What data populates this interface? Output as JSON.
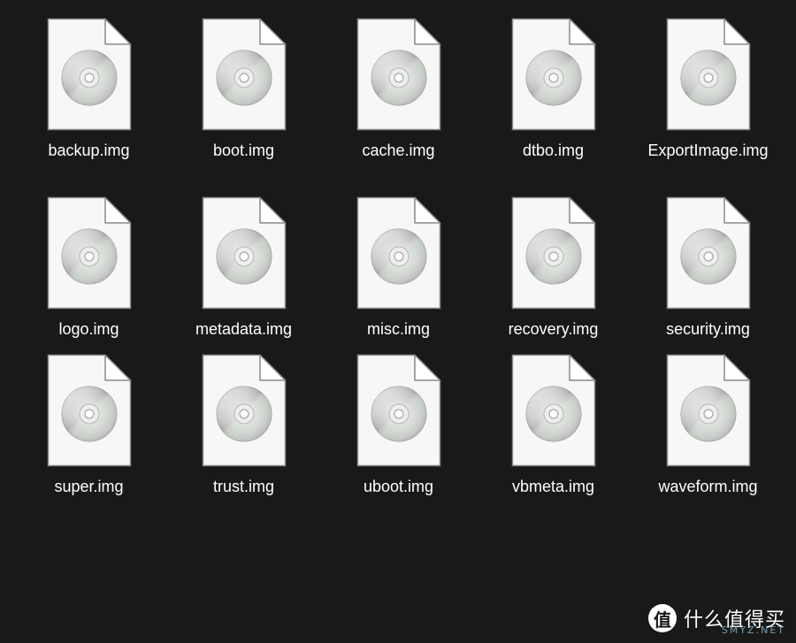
{
  "files": [
    {
      "name": "backup.img",
      "icon": "disc-image-file-icon"
    },
    {
      "name": "boot.img",
      "icon": "disc-image-file-icon"
    },
    {
      "name": "cache.img",
      "icon": "disc-image-file-icon"
    },
    {
      "name": "dtbo.img",
      "icon": "disc-image-file-icon"
    },
    {
      "name": "ExportImage.img",
      "icon": "disc-image-file-icon"
    },
    {
      "name": "logo.img",
      "icon": "disc-image-file-icon"
    },
    {
      "name": "metadata.img",
      "icon": "disc-image-file-icon"
    },
    {
      "name": "misc.img",
      "icon": "disc-image-file-icon"
    },
    {
      "name": "recovery.img",
      "icon": "disc-image-file-icon"
    },
    {
      "name": "security.img",
      "icon": "disc-image-file-icon"
    },
    {
      "name": "super.img",
      "icon": "disc-image-file-icon"
    },
    {
      "name": "trust.img",
      "icon": "disc-image-file-icon"
    },
    {
      "name": "uboot.img",
      "icon": "disc-image-file-icon"
    },
    {
      "name": "vbmeta.img",
      "icon": "disc-image-file-icon"
    },
    {
      "name": "waveform.img",
      "icon": "disc-image-file-icon"
    }
  ],
  "watermark": {
    "logo_glyph": "值",
    "text": "什么值得买",
    "sub_text": "SMYZ.NET"
  },
  "colors": {
    "background": "#191919",
    "label": "#ffffff",
    "page": "#f7f7f7",
    "page_border": "#8a8a8a"
  }
}
